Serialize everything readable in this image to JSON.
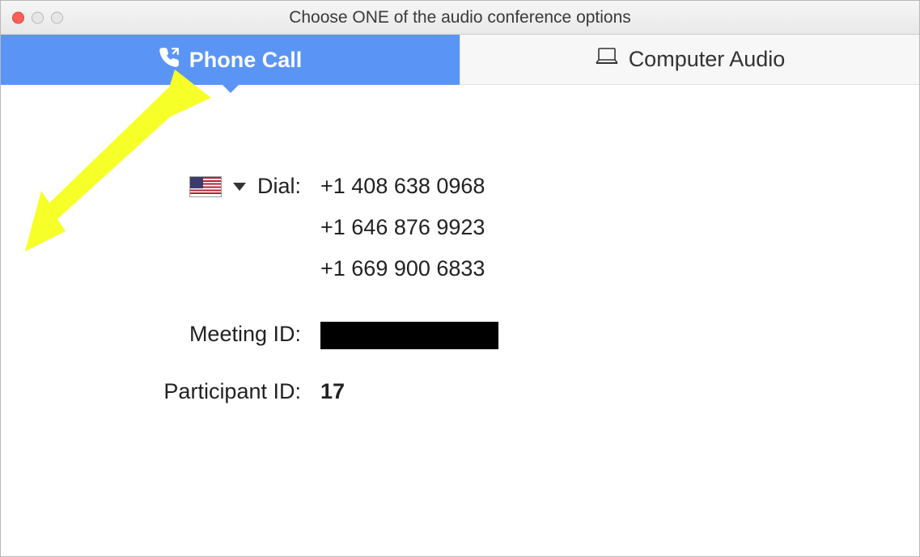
{
  "window": {
    "title": "Choose ONE of the audio conference options"
  },
  "tabs": {
    "phone": {
      "label": "Phone Call",
      "active": true
    },
    "computer": {
      "label": "Computer Audio",
      "active": false
    }
  },
  "dial": {
    "label": "Dial:",
    "country": "US",
    "numbers": [
      "+1 408 638 0968",
      "+1 646 876 9923",
      "+1 669 900 6833"
    ]
  },
  "meeting_id": {
    "label": "Meeting ID:",
    "value": "",
    "redacted": true
  },
  "participant_id": {
    "label": "Participant ID:",
    "value": "17"
  }
}
